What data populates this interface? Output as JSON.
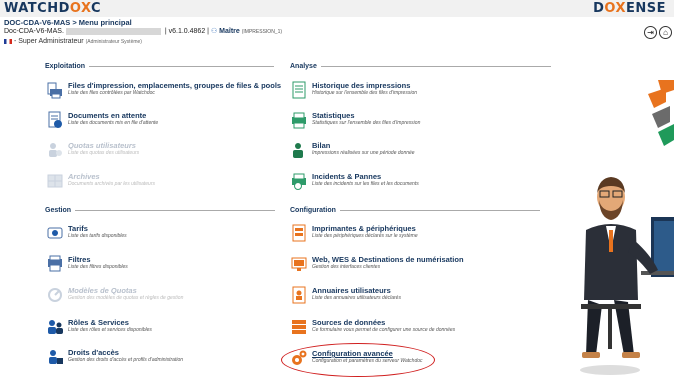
{
  "header": {
    "logo_left_a": "WATCHD",
    "logo_left_ox": "OX",
    "logo_left_b": "C",
    "logo_right_a": "D",
    "logo_right_ox": "OX",
    "logo_right_b": "ENSE",
    "title": "DOC-CDA-V6-MAS > Menu principal",
    "host_prefix": "Doc-CDA-V6-MAS.",
    "version": "| v6.1.0.4862 |",
    "master": "Maître",
    "master_sub": "(IMPRESSION_1)",
    "role": "Super Administrateur",
    "role_sub": "(Administrateur Système)",
    "logout_icon": "logout-icon",
    "home_icon": "home-icon"
  },
  "sections": {
    "exploitation": "Exploitation",
    "analyse": "Analyse",
    "gestion": "Gestion",
    "configuration": "Configuration"
  },
  "exploitation": [
    {
      "title": "Files d'impression, emplacements, groupes de files & pools",
      "desc": "Liste des files contrôlées par Watchdoc"
    },
    {
      "title": "Documents en attente",
      "desc": "Liste des documents mis en file d'attente"
    },
    {
      "title": "Quotas utilisateurs",
      "desc": "Liste des quotas des utilisateurs"
    },
    {
      "title": "Archives",
      "desc": "Documents archivés par les utilisateurs"
    }
  ],
  "gestion": [
    {
      "title": "Tarifs",
      "desc": "Liste des tarifs disponibles"
    },
    {
      "title": "Filtres",
      "desc": "Liste des filtres disponibles"
    },
    {
      "title": "Modèles de Quotas",
      "desc": "Gestion des modèles de quotas et règles de gestion"
    },
    {
      "title": "Rôles & Services",
      "desc": "Liste des rôles et services disponibles"
    },
    {
      "title": "Droits d'accès",
      "desc": "Gestion des droits d'accès et profils d'administration"
    }
  ],
  "analyse": [
    {
      "title": "Historique des impressions",
      "desc": "Historique sur l'ensemble des files d'impression"
    },
    {
      "title": "Statistiques",
      "desc": "Statistiques sur l'ensemble des files d'impression"
    },
    {
      "title": "Bilan",
      "desc": "Impressions réalisées sur une période donnée"
    },
    {
      "title": "Incidents & Pannes",
      "desc": "Liste des incidents sur les files et les documents"
    }
  ],
  "configuration": [
    {
      "title": "Imprimantes & périphériques",
      "desc": "Liste des périphériques déclarés sur le système"
    },
    {
      "title": "Web, WES & Destinations de numérisation",
      "desc": "Gestion des interfaces clientes"
    },
    {
      "title": "Annuaires utilisateurs",
      "desc": "Liste des annuaires utilisateurs déclarés"
    },
    {
      "title": "Sources de données",
      "desc": "Ce formulaire vous permet de configurer une source de données"
    },
    {
      "title": "Configuration avancée",
      "desc": "Configuration et paramètres du serveur Watchdoc"
    }
  ],
  "colors": {
    "brand": "#17375e",
    "accent": "#e8731e",
    "highlight": "#d01f1f"
  }
}
